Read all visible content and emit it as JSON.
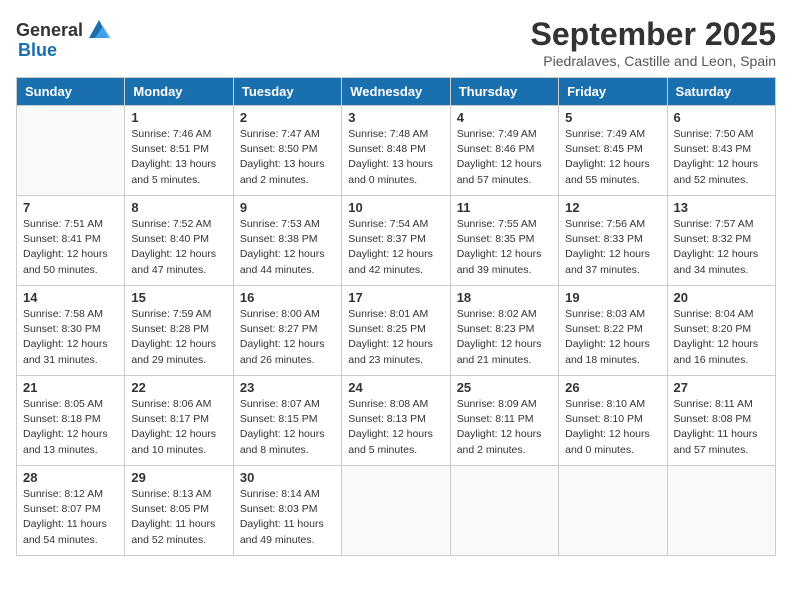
{
  "logo": {
    "general": "General",
    "blue": "Blue"
  },
  "header": {
    "title": "September 2025",
    "subtitle": "Piedralaves, Castille and Leon, Spain"
  },
  "weekdays": [
    "Sunday",
    "Monday",
    "Tuesday",
    "Wednesday",
    "Thursday",
    "Friday",
    "Saturday"
  ],
  "weeks": [
    [
      {
        "date": "",
        "info": ""
      },
      {
        "date": "1",
        "info": "Sunrise: 7:46 AM\nSunset: 8:51 PM\nDaylight: 13 hours\nand 5 minutes."
      },
      {
        "date": "2",
        "info": "Sunrise: 7:47 AM\nSunset: 8:50 PM\nDaylight: 13 hours\nand 2 minutes."
      },
      {
        "date": "3",
        "info": "Sunrise: 7:48 AM\nSunset: 8:48 PM\nDaylight: 13 hours\nand 0 minutes."
      },
      {
        "date": "4",
        "info": "Sunrise: 7:49 AM\nSunset: 8:46 PM\nDaylight: 12 hours\nand 57 minutes."
      },
      {
        "date": "5",
        "info": "Sunrise: 7:49 AM\nSunset: 8:45 PM\nDaylight: 12 hours\nand 55 minutes."
      },
      {
        "date": "6",
        "info": "Sunrise: 7:50 AM\nSunset: 8:43 PM\nDaylight: 12 hours\nand 52 minutes."
      }
    ],
    [
      {
        "date": "7",
        "info": "Sunrise: 7:51 AM\nSunset: 8:41 PM\nDaylight: 12 hours\nand 50 minutes."
      },
      {
        "date": "8",
        "info": "Sunrise: 7:52 AM\nSunset: 8:40 PM\nDaylight: 12 hours\nand 47 minutes."
      },
      {
        "date": "9",
        "info": "Sunrise: 7:53 AM\nSunset: 8:38 PM\nDaylight: 12 hours\nand 44 minutes."
      },
      {
        "date": "10",
        "info": "Sunrise: 7:54 AM\nSunset: 8:37 PM\nDaylight: 12 hours\nand 42 minutes."
      },
      {
        "date": "11",
        "info": "Sunrise: 7:55 AM\nSunset: 8:35 PM\nDaylight: 12 hours\nand 39 minutes."
      },
      {
        "date": "12",
        "info": "Sunrise: 7:56 AM\nSunset: 8:33 PM\nDaylight: 12 hours\nand 37 minutes."
      },
      {
        "date": "13",
        "info": "Sunrise: 7:57 AM\nSunset: 8:32 PM\nDaylight: 12 hours\nand 34 minutes."
      }
    ],
    [
      {
        "date": "14",
        "info": "Sunrise: 7:58 AM\nSunset: 8:30 PM\nDaylight: 12 hours\nand 31 minutes."
      },
      {
        "date": "15",
        "info": "Sunrise: 7:59 AM\nSunset: 8:28 PM\nDaylight: 12 hours\nand 29 minutes."
      },
      {
        "date": "16",
        "info": "Sunrise: 8:00 AM\nSunset: 8:27 PM\nDaylight: 12 hours\nand 26 minutes."
      },
      {
        "date": "17",
        "info": "Sunrise: 8:01 AM\nSunset: 8:25 PM\nDaylight: 12 hours\nand 23 minutes."
      },
      {
        "date": "18",
        "info": "Sunrise: 8:02 AM\nSunset: 8:23 PM\nDaylight: 12 hours\nand 21 minutes."
      },
      {
        "date": "19",
        "info": "Sunrise: 8:03 AM\nSunset: 8:22 PM\nDaylight: 12 hours\nand 18 minutes."
      },
      {
        "date": "20",
        "info": "Sunrise: 8:04 AM\nSunset: 8:20 PM\nDaylight: 12 hours\nand 16 minutes."
      }
    ],
    [
      {
        "date": "21",
        "info": "Sunrise: 8:05 AM\nSunset: 8:18 PM\nDaylight: 12 hours\nand 13 minutes."
      },
      {
        "date": "22",
        "info": "Sunrise: 8:06 AM\nSunset: 8:17 PM\nDaylight: 12 hours\nand 10 minutes."
      },
      {
        "date": "23",
        "info": "Sunrise: 8:07 AM\nSunset: 8:15 PM\nDaylight: 12 hours\nand 8 minutes."
      },
      {
        "date": "24",
        "info": "Sunrise: 8:08 AM\nSunset: 8:13 PM\nDaylight: 12 hours\nand 5 minutes."
      },
      {
        "date": "25",
        "info": "Sunrise: 8:09 AM\nSunset: 8:11 PM\nDaylight: 12 hours\nand 2 minutes."
      },
      {
        "date": "26",
        "info": "Sunrise: 8:10 AM\nSunset: 8:10 PM\nDaylight: 12 hours\nand 0 minutes."
      },
      {
        "date": "27",
        "info": "Sunrise: 8:11 AM\nSunset: 8:08 PM\nDaylight: 11 hours\nand 57 minutes."
      }
    ],
    [
      {
        "date": "28",
        "info": "Sunrise: 8:12 AM\nSunset: 8:07 PM\nDaylight: 11 hours\nand 54 minutes."
      },
      {
        "date": "29",
        "info": "Sunrise: 8:13 AM\nSunset: 8:05 PM\nDaylight: 11 hours\nand 52 minutes."
      },
      {
        "date": "30",
        "info": "Sunrise: 8:14 AM\nSunset: 8:03 PM\nDaylight: 11 hours\nand 49 minutes."
      },
      {
        "date": "",
        "info": ""
      },
      {
        "date": "",
        "info": ""
      },
      {
        "date": "",
        "info": ""
      },
      {
        "date": "",
        "info": ""
      }
    ]
  ]
}
